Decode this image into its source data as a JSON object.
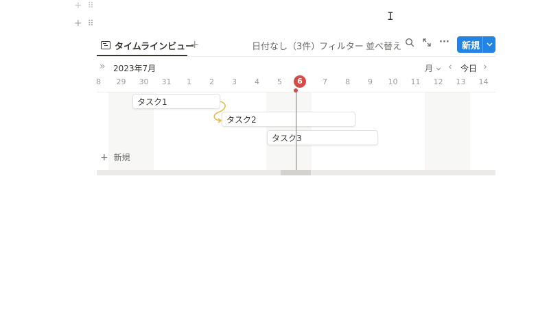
{
  "toolbar": {
    "tab_label": "タイムラインビュー",
    "add_view": "+",
    "no_date": "日付なし（3件）",
    "filter": "フィルター",
    "sort": "並べ替え",
    "more": "···",
    "new_label": "新規",
    "new_chevron": "⌄"
  },
  "timeline": {
    "collapse": "»",
    "month_label": "2023年7月",
    "scale": "月",
    "scale_chevron": "⌄",
    "prev": "‹",
    "today": "今日",
    "next": "›",
    "dates": [
      "8",
      "29",
      "30",
      "31",
      "1",
      "2",
      "3",
      "4",
      "5",
      "6",
      "7",
      "8",
      "9",
      "10",
      "11",
      "12",
      "13",
      "14"
    ],
    "today_date": "6"
  },
  "tasks": [
    {
      "label": "タスク1"
    },
    {
      "label": "タスク2"
    },
    {
      "label": "タスク3"
    }
  ],
  "new_row": {
    "icon": "+",
    "label": "新規"
  },
  "handles": {
    "plus": "+",
    "drag": "⠿"
  },
  "colors": {
    "accent": "#2383e2",
    "today": "#d44c47",
    "dependency": "#e9b949"
  }
}
